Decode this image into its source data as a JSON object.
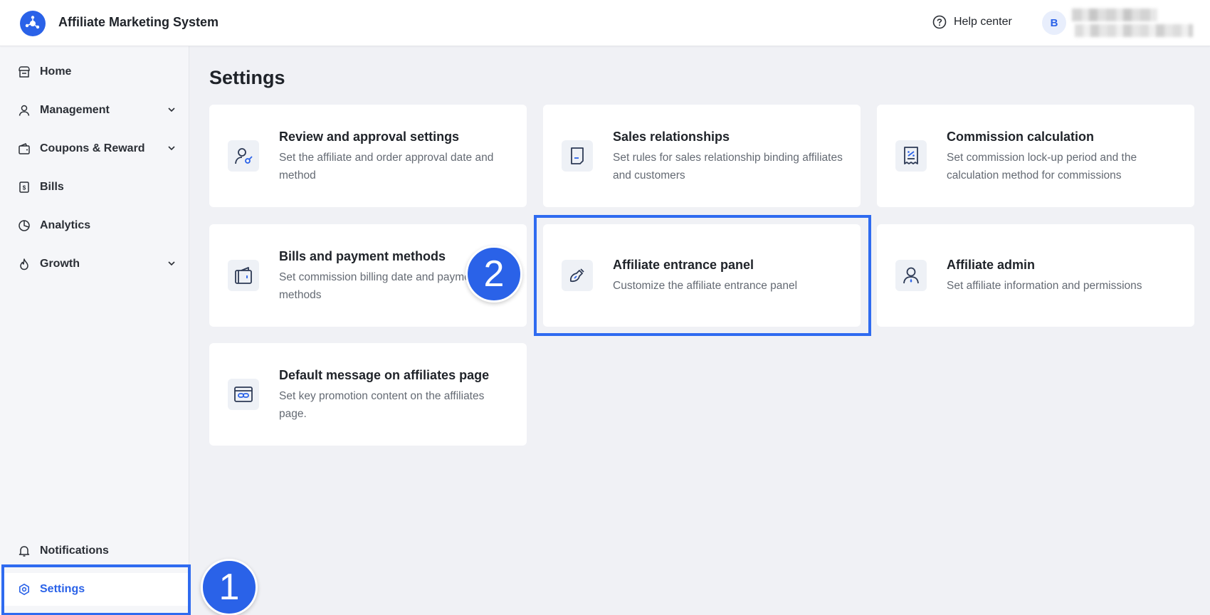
{
  "header": {
    "app_title": "Affiliate Marketing System",
    "help_label": "Help center",
    "avatar_initial": "B"
  },
  "sidebar": {
    "items": [
      {
        "label": "Home",
        "icon": "store-icon"
      },
      {
        "label": "Management",
        "icon": "user-icon",
        "expandable": true
      },
      {
        "label": "Coupons & Reward",
        "icon": "wallet-icon",
        "expandable": true
      },
      {
        "label": "Bills",
        "icon": "bill-icon"
      },
      {
        "label": "Analytics",
        "icon": "pie-chart-icon"
      },
      {
        "label": "Growth",
        "icon": "flame-icon",
        "expandable": true
      }
    ],
    "bottom_items": [
      {
        "label": "Notifications",
        "icon": "bell-icon"
      },
      {
        "label": "Settings",
        "icon": "gear-icon",
        "active": true
      }
    ]
  },
  "main": {
    "page_title": "Settings",
    "cards": [
      {
        "title": "Review and approval settings",
        "desc": "Set the affiliate and order approval date and method",
        "icon": "user-approval-icon"
      },
      {
        "title": "Sales relationships",
        "desc": "Set rules for sales relationship binding affiliates and customers",
        "icon": "document-icon"
      },
      {
        "title": "Commission calculation",
        "desc": "Set commission lock-up period and the calculation method for commissions",
        "icon": "receipt-percent-icon"
      },
      {
        "title": "Bills and payment methods",
        "desc": "Set commission billing date and payment methods",
        "icon": "wallet-card-icon"
      },
      {
        "title": "Affiliate entrance panel",
        "desc": "Customize the affiliate entrance panel",
        "icon": "brush-icon"
      },
      {
        "title": "Affiliate admin",
        "desc": "Set affiliate information and permissions",
        "icon": "admin-user-icon"
      },
      {
        "title": "Default message on affiliates page",
        "desc": "Set key promotion content on the affiliates page.",
        "icon": "browser-link-icon"
      }
    ]
  },
  "annotations": {
    "step1": "1",
    "step2": "2"
  },
  "colors": {
    "accent": "#2a62e8",
    "highlight_border": "#2f6bf0",
    "page_bg": "#f0f1f5"
  }
}
